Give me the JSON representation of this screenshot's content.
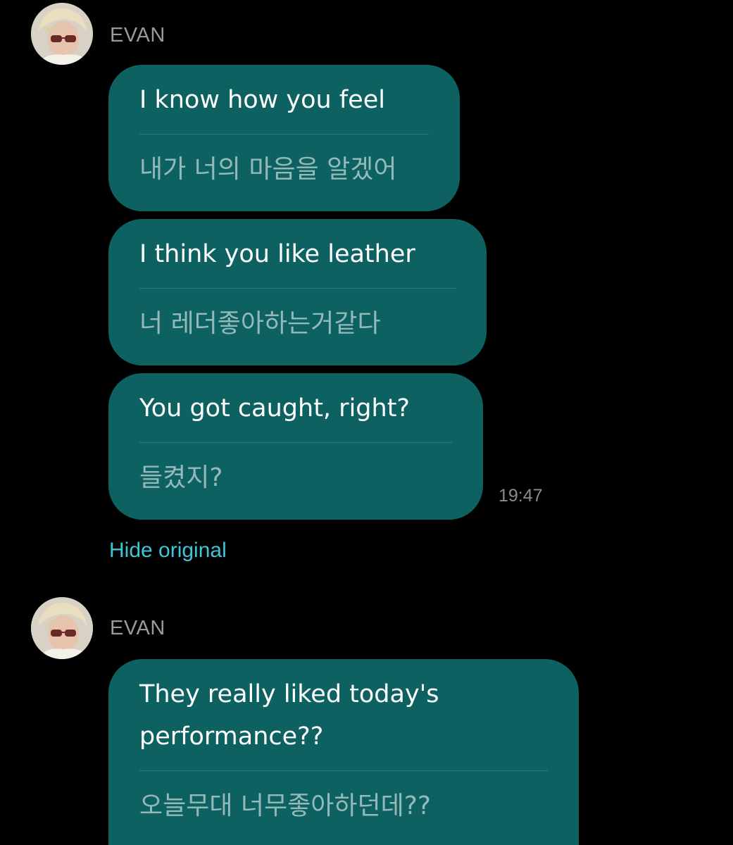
{
  "conversation": {
    "groups": [
      {
        "sender": "EVAN",
        "messages": [
          {
            "translated": "I know how you feel",
            "original": "내가 너의 마음을 알겠어"
          },
          {
            "translated": "I think you like leather",
            "original": "너 레더좋아하는거같다"
          },
          {
            "translated": "You got caught, right?",
            "original": "들켰지?"
          }
        ],
        "timestamp": "19:47",
        "toggle_label": "Hide original"
      },
      {
        "sender": "EVAN",
        "messages": [
          {
            "translated": "They really liked today's\nperformance??",
            "original": "오늘무대 너무좋아하던데??"
          }
        ]
      }
    ]
  },
  "colors": {
    "background": "#000000",
    "bubble": "#0d6161",
    "translated_text": "#ffffff",
    "original_text": "#93b9b9",
    "link": "#3dc7d6",
    "meta_text": "#8c8c8c"
  },
  "icons": {
    "avatar": "profile-photo"
  }
}
